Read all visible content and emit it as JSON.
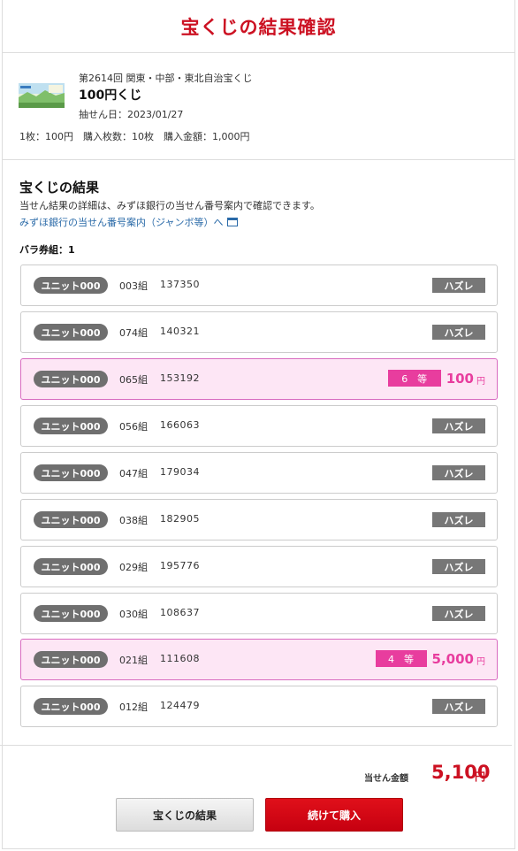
{
  "header": {
    "title": "宝くじの結果確認"
  },
  "ticket": {
    "round": "第2614回 関東・中部・東北自治宝くじ",
    "name": "100円くじ",
    "draw_date": "抽せん日：2023/01/27",
    "summary": "1枚：100円　購入枚数：10枚　購入金額：1,000円",
    "thumbnail": "lottery-ticket-image"
  },
  "results": {
    "heading": "宝くじの結果",
    "description": "当せん結果の詳細は、みずほ銀行の当せん番号案内で確認できます。",
    "link_label": "みずほ銀行の当せん番号案内（ジャンボ等）へ",
    "bara_label": "バラ券組：1",
    "rows": [
      {
        "unit": "ユニット000",
        "kumi": "003組",
        "number": "137350",
        "status": "ハズレ"
      },
      {
        "unit": "ユニット000",
        "kumi": "074組",
        "number": "140321",
        "status": "ハズレ"
      },
      {
        "unit": "ユニット000",
        "kumi": "065組",
        "number": "153192",
        "rank": "6　等",
        "amount": "100",
        "yen": "円"
      },
      {
        "unit": "ユニット000",
        "kumi": "056組",
        "number": "166063",
        "status": "ハズレ"
      },
      {
        "unit": "ユニット000",
        "kumi": "047組",
        "number": "179034",
        "status": "ハズレ"
      },
      {
        "unit": "ユニット000",
        "kumi": "038組",
        "number": "182905",
        "status": "ハズレ"
      },
      {
        "unit": "ユニット000",
        "kumi": "029組",
        "number": "195776",
        "status": "ハズレ"
      },
      {
        "unit": "ユニット000",
        "kumi": "030組",
        "number": "108637",
        "status": "ハズレ"
      },
      {
        "unit": "ユニット000",
        "kumi": "021組",
        "number": "111608",
        "rank": "4　等",
        "amount": "5,000",
        "yen": "円"
      },
      {
        "unit": "ユニット000",
        "kumi": "012組",
        "number": "124479",
        "status": "ハズレ"
      }
    ]
  },
  "total": {
    "label": "当せん金額",
    "amount": "5,100",
    "yen": "円"
  },
  "buttons": {
    "results": "宝くじの結果",
    "continue": "続けて購入"
  },
  "colors": {
    "brand_red": "#cc1122",
    "win_pink": "#e83d9e",
    "win_bg": "#fde6f5",
    "link_blue": "#2a6aa8"
  }
}
